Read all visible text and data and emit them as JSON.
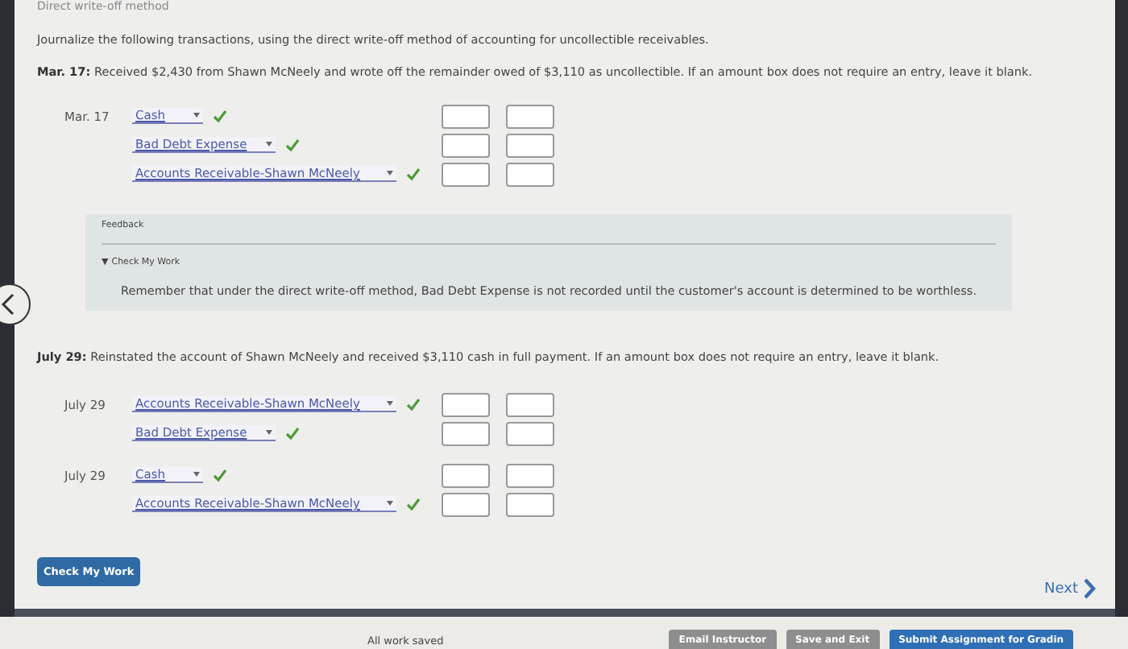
{
  "header": {
    "title": "Direct write-off method"
  },
  "instructions": "Journalize the following transactions, using the direct write-off method of accounting for uncollectible receivables.",
  "questions": [
    {
      "prompt": "**Mar. 17:** Received $2,430 from Shawn McNeely and wrote off the remainder owed of $3,110 as uncollectible. If an amount box does not require an entry, leave it blank.",
      "entries": [
        {
          "lines": [
            {
              "date": "Mar. 17",
              "account": "Cash",
              "correct": true
            },
            {
              "account": "Bad Debt Expense",
              "correct": true
            },
            {
              "account": "Accounts Receivable-Shawn McNeely",
              "correct": true
            }
          ]
        }
      ],
      "feedback": {
        "title": "Feedback",
        "toggle": "▼",
        "toggle_label": "Check My Work",
        "expanded": true,
        "message": "Remember that under the direct write-off method, Bad Debt Expense is not recorded until the customer's account is determined to be worthless."
      }
    },
    {
      "prompt": "**July 29:** Reinstated the account of Shawn McNeely and received $3,110 cash in full payment. If an amount box does not require an entry, leave it blank.",
      "entries": [
        {
          "lines": [
            {
              "date": "July 29",
              "account": "Accounts Receivable-Shawn McNeely",
              "correct": true
            },
            {
              "account": "Bad Debt Expense",
              "correct": true
            }
          ]
        },
        {
          "lines": [
            {
              "date": "July 29",
              "account": "Cash",
              "correct": true
            },
            {
              "account": "Accounts Receivable-Shawn McNeely",
              "correct": true
            }
          ]
        }
      ]
    }
  ],
  "check_button": "Check My Work",
  "next_button": "Next",
  "footer": {
    "status": "All work saved",
    "buttons": [
      {
        "label": "Email Instructor",
        "kind": "secondary"
      },
      {
        "label": "Save and Exit",
        "kind": "secondary"
      },
      {
        "label": "Submit Assignment for Gradin",
        "kind": "primary"
      }
    ]
  }
}
